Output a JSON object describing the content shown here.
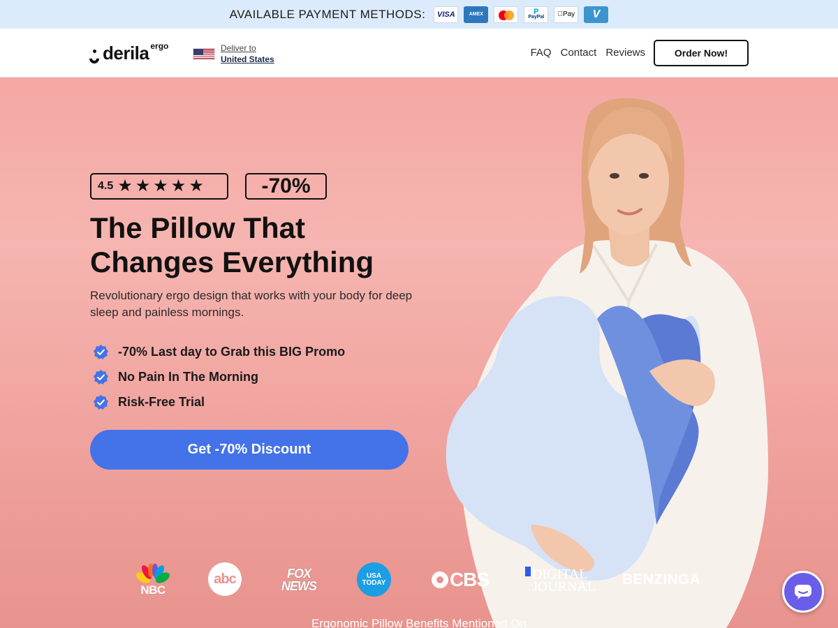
{
  "payment_bar": {
    "label": "AVAILABLE PAYMENT METHODS:",
    "methods": [
      {
        "name": "VISA",
        "icon": "visa-card-icon"
      },
      {
        "name": "AMEX",
        "icon": "amex-card-icon"
      },
      {
        "name": "",
        "icon": "mastercard-icon"
      },
      {
        "name": "PayPal",
        "icon": "paypal-card-icon"
      },
      {
        "name": "Pay",
        "icon": "apple-pay-icon"
      },
      {
        "name": "V",
        "icon": "venmo-card-icon"
      }
    ]
  },
  "header": {
    "logo": {
      "word": "derila",
      "sup": "ergo"
    },
    "deliver": {
      "line1": "Deliver to",
      "line2": "United States"
    },
    "nav": [
      "FAQ",
      "Contact",
      "Reviews"
    ],
    "order_button": "Order Now!"
  },
  "hero": {
    "rating": "4.5",
    "stars": 5,
    "discount_badge": "-70%",
    "title_line1": "The Pillow That",
    "title_line2": "Changes Everything",
    "subtitle": "Revolutionary ergo design that works with your body for deep sleep and painless mornings.",
    "benefits": [
      "-70% Last day to Grab this BIG Promo",
      "No Pain In The Morning",
      "Risk-Free Trial"
    ],
    "cta": "Get -70% Discount"
  },
  "press": {
    "logos": {
      "nbc": "NBC",
      "abc": "abc",
      "fox_line1": "FOX",
      "fox_line2": "NEWS",
      "usat_line1": "USA",
      "usat_line2": "TODAY",
      "cbs": "CBS",
      "dj_line1": "DIGITAL",
      "dj_line2": "JOURNAL",
      "benzinga": "BENZINGA"
    },
    "caption": "Ergonomic Pillow Benefits Mentioned On"
  },
  "colors": {
    "accent": "#4472e8",
    "hero_bg": "#f4a8a4",
    "payment_bar_bg": "#dcebfb",
    "chat": "#6a5ee8"
  }
}
